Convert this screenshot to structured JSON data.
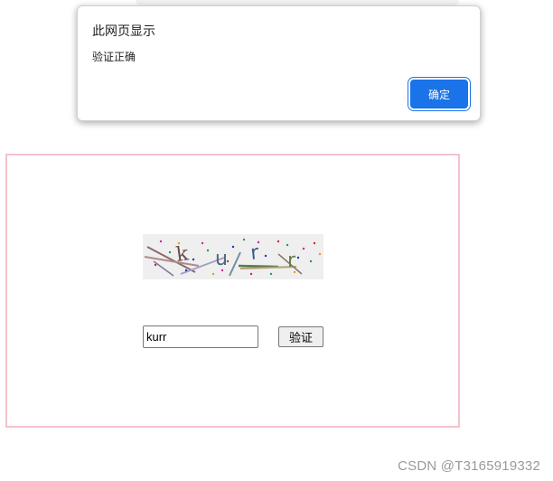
{
  "alert": {
    "title": "此网页显示",
    "message": "验证正确",
    "ok_label": "确定",
    "accent_color": "#1a73e8"
  },
  "captcha": {
    "characters": [
      "k",
      "u",
      "r",
      "r"
    ],
    "border_color": "#f4c2cb",
    "input_value": "kurr",
    "verify_label": "验证"
  },
  "watermark": {
    "text": "CSDN @T3165919332"
  }
}
